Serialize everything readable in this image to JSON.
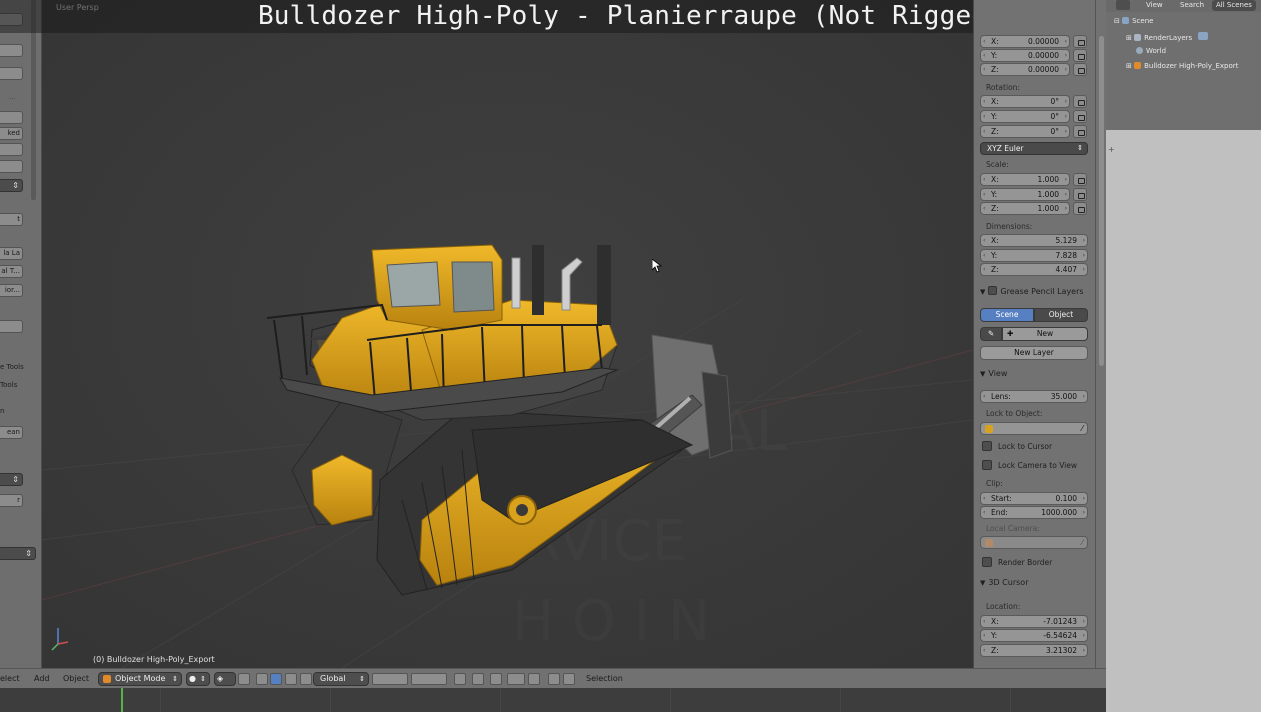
{
  "title": "Bulldozer High-Poly - Planierraupe (Not Rigged)",
  "viewport": {
    "view_label": "User Persp",
    "object_label": "(0) Bulldozer High-Poly_Export"
  },
  "left_shelf": {
    "labels": [
      "ked",
      "t",
      "la La",
      "al T...",
      "ior...",
      "e Tools",
      "Tools",
      "n",
      "ean",
      "r"
    ]
  },
  "properties": {
    "location": [
      {
        "axis": "X:",
        "value": "0.00000"
      },
      {
        "axis": "Y:",
        "value": "0.00000"
      },
      {
        "axis": "Z:",
        "value": "0.00000"
      }
    ],
    "rotation_label": "Rotation:",
    "rotation": [
      {
        "axis": "X:",
        "value": "0°"
      },
      {
        "axis": "Y:",
        "value": "0°"
      },
      {
        "axis": "Z:",
        "value": "0°"
      }
    ],
    "rotation_mode": "XYZ Euler",
    "scale_label": "Scale:",
    "scale": [
      {
        "axis": "X:",
        "value": "1.000"
      },
      {
        "axis": "Y:",
        "value": "1.000"
      },
      {
        "axis": "Z:",
        "value": "1.000"
      }
    ],
    "dimensions_label": "Dimensions:",
    "dimensions": [
      {
        "axis": "X:",
        "value": "5.129"
      },
      {
        "axis": "Y:",
        "value": "7.828"
      },
      {
        "axis": "Z:",
        "value": "4.407"
      }
    ],
    "grease_pencil": {
      "title": "Grease Pencil Layers",
      "tab_scene": "Scene",
      "tab_object": "Object",
      "new_label": "New",
      "new_layer_label": "New Layer"
    },
    "view": {
      "title": "View",
      "lens_label": "Lens:",
      "lens_value": "35.000",
      "lock_to_object_label": "Lock to Object:",
      "lock_to_cursor": "Lock to Cursor",
      "lock_camera_to_view": "Lock Camera to View",
      "clip_label": "Clip:",
      "clip_start_label": "Start:",
      "clip_start_value": "0.100",
      "clip_end_label": "End:",
      "clip_end_value": "1000.000",
      "local_camera_label": "Local Camera:",
      "render_border": "Render Border"
    },
    "cursor": {
      "title": "3D Cursor",
      "location_label": "Location:",
      "location": [
        {
          "axis": "X:",
          "value": "-7.01243"
        },
        {
          "axis": "Y:",
          "value": "-6.54624"
        },
        {
          "axis": "Z:",
          "value": "3.21302"
        }
      ]
    }
  },
  "outliner": {
    "header": [
      "View",
      "Search",
      "All Scenes"
    ],
    "tree": [
      {
        "label": "Scene"
      },
      {
        "label": "RenderLayers"
      },
      {
        "label": "World"
      },
      {
        "label": "Bulldozer High-Poly_Export"
      }
    ]
  },
  "bottom_bar": {
    "menu_select": "elect",
    "menu_add": "Add",
    "menu_object": "Object",
    "mode": "Object Mode",
    "orientation": "Global",
    "selection": "Selection"
  },
  "colors": {
    "body_yellow": "#d9a21c",
    "active_blue": "#5680c2",
    "timeline_green": "#59b14b"
  }
}
